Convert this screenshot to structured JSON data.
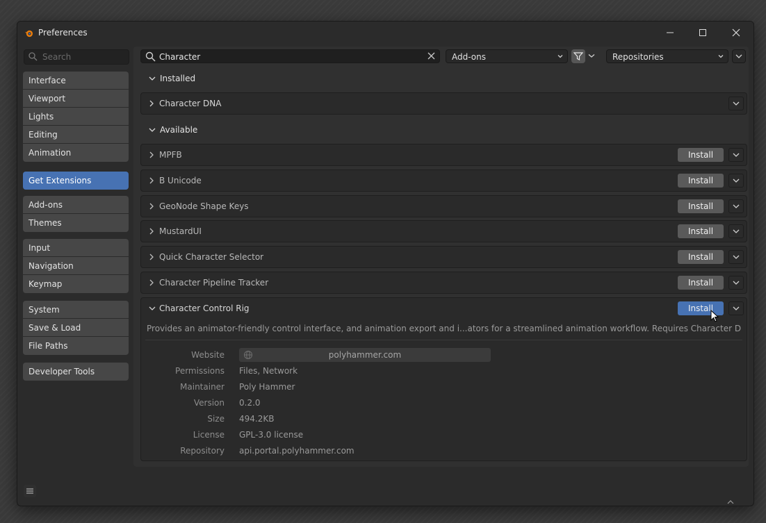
{
  "window": {
    "title": "Preferences"
  },
  "sidebar": {
    "search_placeholder": "Search",
    "groups": [
      [
        "Interface",
        "Viewport",
        "Lights",
        "Editing",
        "Animation"
      ],
      [
        "Get Extensions"
      ],
      [
        "Add-ons",
        "Themes"
      ],
      [
        "Input",
        "Navigation",
        "Keymap"
      ],
      [
        "System",
        "Save & Load",
        "File Paths"
      ],
      [
        "Developer Tools"
      ]
    ],
    "active": "Get Extensions"
  },
  "toolbar": {
    "search_value": "Character",
    "type_dropdown": "Add-ons",
    "repo_dropdown": "Repositories"
  },
  "sections": {
    "installed": "Installed",
    "available": "Available"
  },
  "installed": [
    {
      "name": "Character DNA"
    }
  ],
  "available": [
    {
      "name": "MPFB",
      "button": "Install"
    },
    {
      "name": "B Unicode",
      "button": "Install"
    },
    {
      "name": "GeoNode Shape Keys",
      "button": "Install"
    },
    {
      "name": "MustardUI",
      "button": "Install"
    },
    {
      "name": "Quick Character Selector",
      "button": "Install"
    },
    {
      "name": "Character Pipeline Tracker",
      "button": "Install"
    }
  ],
  "expanded": {
    "name": "Character Control Rig",
    "button": "Install",
    "description": "Provides an animator-friendly control interface, and animation export and i...ators for a streamlined animation workflow. Requires Character DNA addon..",
    "fields": {
      "website_label": "Website",
      "website_value": "polyhammer.com",
      "permissions_label": "Permissions",
      "permissions_value": "Files, Network",
      "maintainer_label": "Maintainer",
      "maintainer_value": "Poly Hammer",
      "version_label": "Version",
      "version_value": "0.2.0",
      "size_label": "Size",
      "size_value": "494.2KB",
      "license_label": "License",
      "license_value": "GPL-3.0 license",
      "repository_label": "Repository",
      "repository_value": "api.portal.polyhammer.com"
    }
  },
  "colors": {
    "accent": "#4772b3",
    "nav_bg": "#474747",
    "panel_bg": "#303030"
  }
}
